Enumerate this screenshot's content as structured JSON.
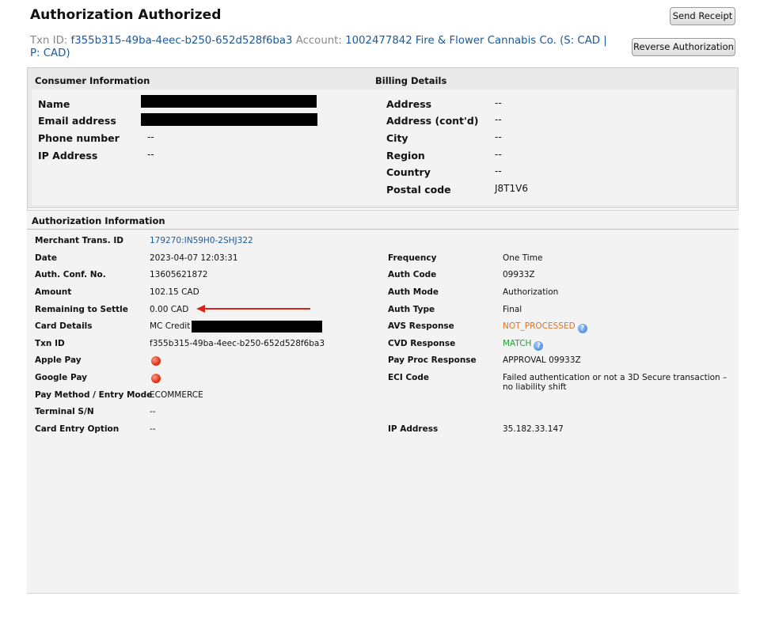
{
  "header": {
    "title": "Authorization Authorized",
    "send_receipt": "Send Receipt",
    "reverse_authorization": "Reverse Authorization",
    "txn_id_label": "Txn ID:",
    "txn_id_value": "f355b315-49ba-4eec-b250-652d528f6ba3",
    "account_label": "Account:",
    "account_value": "1002477842 Fire & Flower Cannabis Co. (S: CAD | P: CAD)"
  },
  "consumer": {
    "heading": "Consumer Information",
    "fields": [
      {
        "label": "Name",
        "value": ""
      },
      {
        "label": "Email address",
        "value": ""
      },
      {
        "label": "Phone number",
        "value": "--"
      },
      {
        "label": "IP Address",
        "value": "--"
      }
    ]
  },
  "billing": {
    "heading": "Billing Details",
    "fields": [
      {
        "label": "Address",
        "value": "--"
      },
      {
        "label": "Address (cont'd)",
        "value": "--"
      },
      {
        "label": "City",
        "value": "--"
      },
      {
        "label": "Region",
        "value": "--"
      },
      {
        "label": "Country",
        "value": "--"
      },
      {
        "label": "Postal code",
        "value": "J8T1V6"
      }
    ]
  },
  "authorization": {
    "heading": "Authorization Information",
    "left": [
      {
        "label": "Merchant Trans. ID",
        "value": "179270:IN59H0-2SHJ322"
      },
      {
        "label": "Date",
        "value": "2023-04-07 12:03:31"
      },
      {
        "label": "Auth. Conf. No.",
        "value": "13605621872"
      },
      {
        "label": "Amount",
        "value": "102.15 CAD"
      },
      {
        "label": "Remaining to Settle",
        "value": "0.00 CAD"
      },
      {
        "label": "Card Details",
        "value": "MC Credit"
      },
      {
        "label": "Txn ID",
        "value": "f355b315-49ba-4eec-b250-652d528f6ba3"
      },
      {
        "label": "Apple Pay",
        "value": ""
      },
      {
        "label": "Google Pay",
        "value": ""
      },
      {
        "label": "Pay Method / Entry Mode",
        "value": "ECOMMERCE"
      },
      {
        "label": "Terminal S/N",
        "value": "--"
      },
      {
        "label": "Card Entry Option",
        "value": "--"
      }
    ],
    "right": [
      {
        "label": "Frequency",
        "value": "One Time"
      },
      {
        "label": "Auth Code",
        "value": "09933Z"
      },
      {
        "label": "Auth Mode",
        "value": "Authorization"
      },
      {
        "label": "Auth Type",
        "value": "Final"
      },
      {
        "label": "AVS Response",
        "value": "NOT_PROCESSED"
      },
      {
        "label": "CVD Response",
        "value": "MATCH"
      },
      {
        "label": "Pay Proc Response",
        "value": "APPROVAL 09933Z"
      },
      {
        "label": "ECI Code",
        "value": "Failed authentication or not a 3D Secure transaction – no liability shift"
      },
      {
        "label": "IP Address",
        "value": "35.182.33.147"
      }
    ],
    "help_icon": "?"
  },
  "colors": {
    "link": "#1a5a9a",
    "warning": "#e0702a",
    "success": "#2a9a3a",
    "annotation_arrow": "#d4261a"
  }
}
